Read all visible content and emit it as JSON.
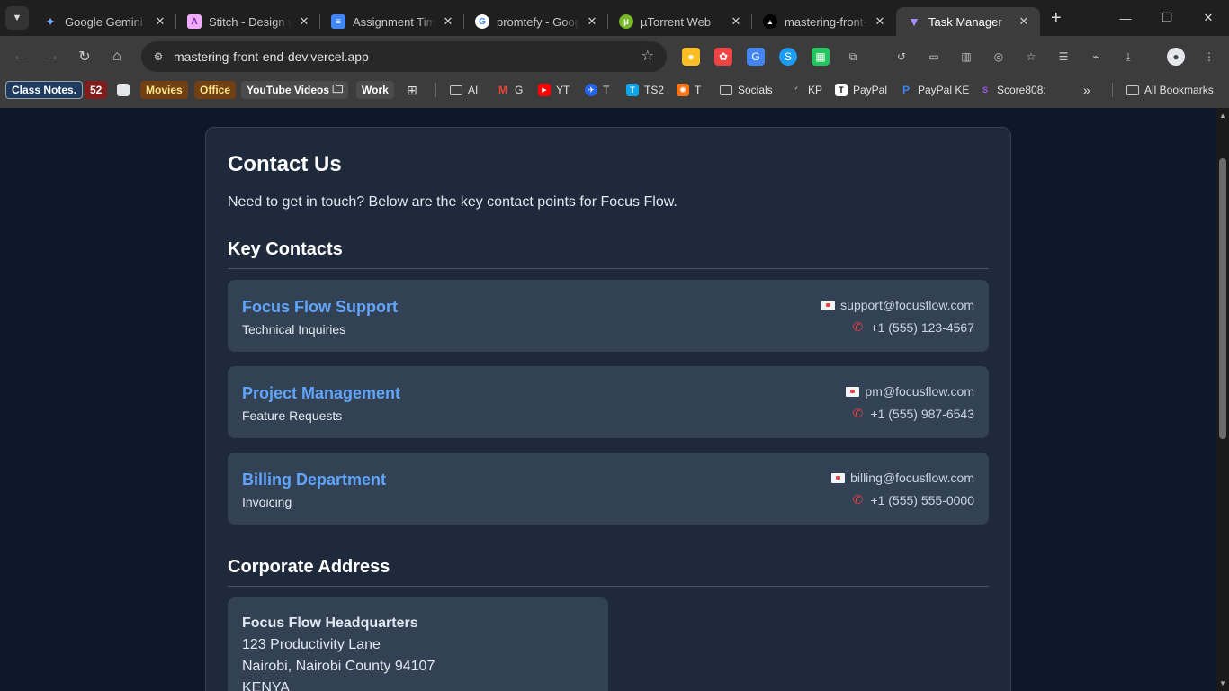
{
  "browser": {
    "tabs": [
      {
        "title": "Google Gemini",
        "icon": "gemini-icon",
        "active": false
      },
      {
        "title": "Stitch - Design with AI",
        "icon": "stitch-icon",
        "active": false
      },
      {
        "title": "Assignment Timeline",
        "icon": "docs-icon",
        "active": false
      },
      {
        "title": "promtefy - Google Search",
        "icon": "google-icon",
        "active": false
      },
      {
        "title": "µTorrent Web",
        "icon": "utorrent-icon",
        "active": false
      },
      {
        "title": "mastering-front-end-dev",
        "icon": "vercel-icon",
        "active": false
      },
      {
        "title": "Task Manager",
        "icon": "vite-icon",
        "active": true
      }
    ],
    "url": "mastering-front-end-dev.vercel.app"
  },
  "bookmarks": {
    "chip_class_notes": "Class Notes.",
    "chip_52": "52",
    "chip_movies": "Movies",
    "chip_office": "Office",
    "chip_youtube": "YouTube Videos",
    "work": "Work",
    "ai": "AI",
    "gmail": "G",
    "yt": "YT",
    "t1": "T",
    "ts2": "TS2",
    "t2": "T",
    "socials": "Socials",
    "kp": "KP",
    "paypal": "PayPal",
    "paypal_ke": "PayPal KE",
    "score808": "Score808:",
    "all": "All Bookmarks"
  },
  "page": {
    "title": "Contact Us",
    "intro": "Need to get in touch? Below are the key contact points for Focus Flow.",
    "key_contacts_heading": "Key Contacts",
    "contacts": [
      {
        "name": "Focus Flow Support",
        "dept": "Technical Inquiries",
        "email": "support@focusflow.com",
        "phone": "+1 (555) 123-4567"
      },
      {
        "name": "Project Management",
        "dept": "Feature Requests",
        "email": "pm@focusflow.com",
        "phone": "+1 (555) 987-6543"
      },
      {
        "name": "Billing Department",
        "dept": "Invoicing",
        "email": "billing@focusflow.com",
        "phone": "+1 (555) 555-0000"
      }
    ],
    "address_heading": "Corporate Address",
    "address": {
      "name": "Focus Flow Headquarters",
      "street": "123 Productivity Lane",
      "city": "Nairobi, Nairobi County 94107",
      "country": "KENYA"
    }
  },
  "colors": {
    "page_bg": "#0f172a",
    "card_bg": "#1e293b",
    "tile_bg": "#334155",
    "accent": "#60a5fa"
  }
}
